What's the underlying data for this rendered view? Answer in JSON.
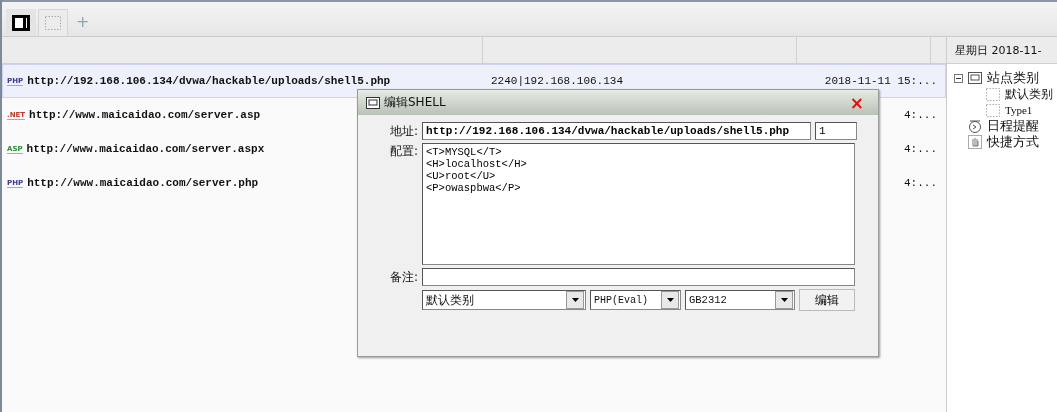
{
  "tabs": [
    {
      "kind": "panel",
      "selected": true
    },
    {
      "kind": "dotted",
      "selected": false
    }
  ],
  "add_tab": "+",
  "list": {
    "rows": [
      {
        "type_label": "PHP",
        "kind": "php",
        "url": "http://192.168.106.134/dvwa/hackable/uploads/shell5.php",
        "column_2": "2240|192.168.106.134",
        "column_3": "2018-11-11 15:...",
        "selected": true
      },
      {
        "type_label": ".NET",
        "kind": "net",
        "url": "http://www.maicaidao.com/server.asp",
        "column_3": "4:...",
        "selected": false
      },
      {
        "type_label": "ASP",
        "kind": "asp",
        "url": "http://www.maicaidao.com/server.aspx",
        "column_3": "4:...",
        "selected": false
      },
      {
        "type_label": "PHP",
        "kind": "php",
        "url": "http://www.maicaidao.com/server.php",
        "column_3": "4:...",
        "selected": false
      }
    ]
  },
  "sidebar": {
    "date": "星期日 2018-11-",
    "tree": [
      {
        "label": "站点类别",
        "kind": "folder",
        "expanded": true,
        "children": [
          {
            "label": "默认类别",
            "kind": "item"
          },
          {
            "label": "Type1",
            "kind": "item"
          }
        ]
      },
      {
        "label": "日程提醒",
        "kind": "clock"
      },
      {
        "label": "快捷方式",
        "kind": "hand"
      }
    ]
  },
  "dialog": {
    "title": "编辑SHELL",
    "close": "×",
    "address_label": "地址:",
    "address": "http://192.168.106.134/dvwa/hackable/uploads/shell5.php",
    "address_extra": "1",
    "config_label": "配置:",
    "config_lines": [
      "<T>MYSQL</T>",
      "<H>localhost</H>",
      "<U>root</U>",
      "<P>owaspbwa</P>"
    ],
    "note_label": "备注:",
    "dropdowns": [
      "默认类别",
      "PHP(Eval)",
      "GB2312"
    ],
    "button": "编辑"
  }
}
